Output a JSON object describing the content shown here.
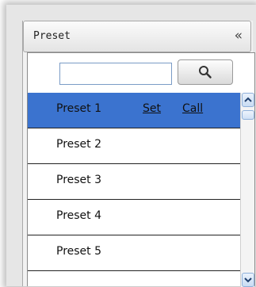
{
  "panel": {
    "title": "Preset",
    "collapse_glyph": "«",
    "collapse_icon": "double-chevron-left-icon"
  },
  "search": {
    "value": "",
    "placeholder": "",
    "button_icon": "search-icon"
  },
  "presets": [
    {
      "label": "Preset 1",
      "selected": true,
      "set_label": "Set",
      "call_label": "Call"
    },
    {
      "label": "Preset 2",
      "selected": false
    },
    {
      "label": "Preset 3",
      "selected": false
    },
    {
      "label": "Preset 4",
      "selected": false
    },
    {
      "label": "Preset 5",
      "selected": false
    }
  ],
  "colors": {
    "selected_row": "#3b73cf",
    "search_border": "#7a9cc6"
  }
}
